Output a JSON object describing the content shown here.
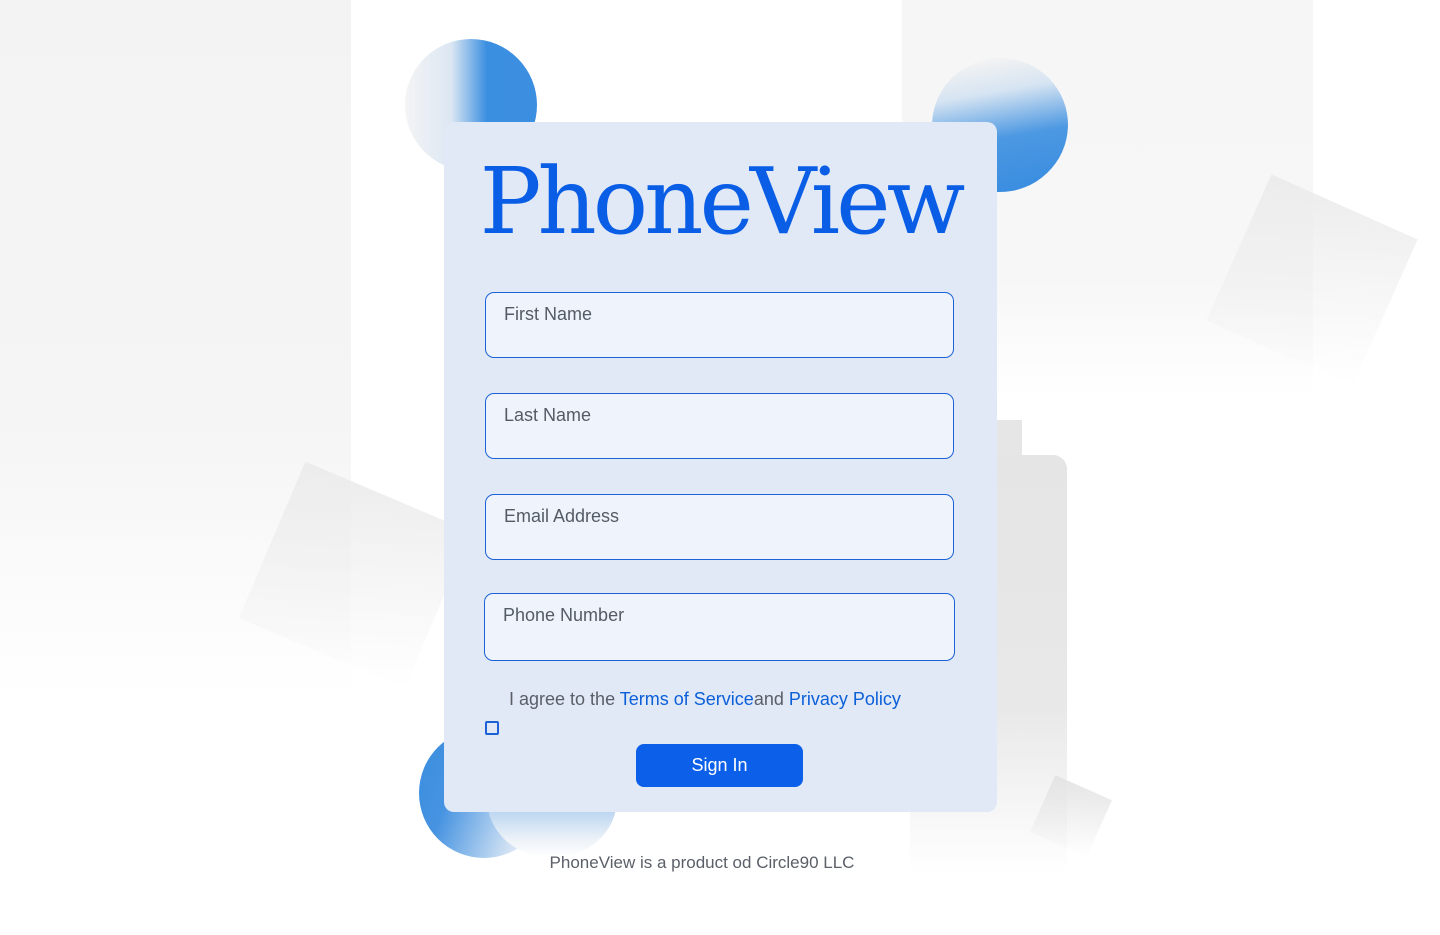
{
  "brand": {
    "logo_text": "PhoneView",
    "logo_color": "#0a5ee6"
  },
  "form": {
    "fields": [
      {
        "label": "First Name",
        "value": ""
      },
      {
        "label": "Last Name",
        "value": ""
      },
      {
        "label": "Email Address",
        "value": ""
      },
      {
        "label": "Phone Number",
        "value": ""
      }
    ],
    "agreement": {
      "prefix": "I agree to the",
      "terms_link": "Terms of Service",
      "conjunction": "and",
      "privacy_link": "Privacy Policy",
      "checked": false
    },
    "submit_label": "Sign In"
  },
  "footer": {
    "text": "PhoneView is a product od Circle90 LLC"
  },
  "colors": {
    "accent": "#0b5fe8",
    "card_background": "#e1e9f6",
    "field_border": "#1a62d6",
    "decorative_blue": "#3a8de0"
  }
}
